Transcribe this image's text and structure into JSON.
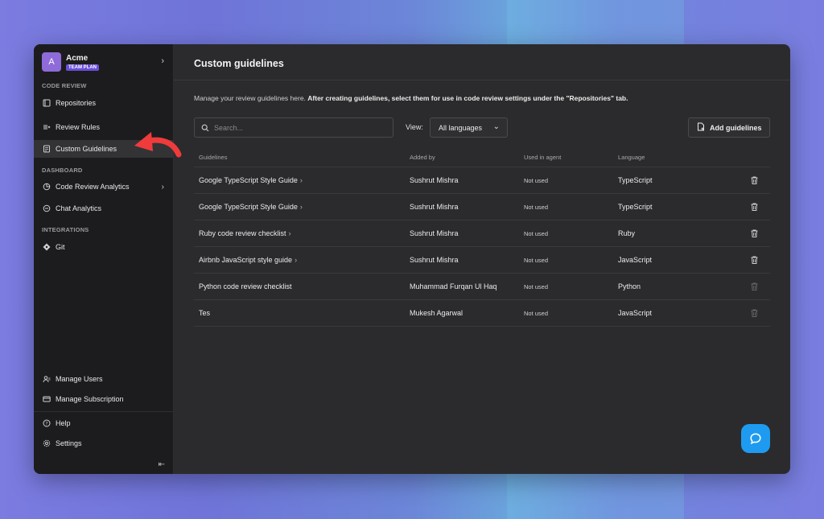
{
  "org": {
    "initial": "A",
    "name": "Acme",
    "plan": "TEAM PLAN"
  },
  "sidebar": {
    "section_code_review": "CODE REVIEW",
    "section_dashboard": "DASHBOARD",
    "section_integrations": "INTEGRATIONS",
    "items": [
      {
        "label": "Repositories",
        "icon": "repositories-icon"
      },
      {
        "label": "Review Rules",
        "icon": "review-rules-icon"
      },
      {
        "label": "Custom Guidelines",
        "icon": "guidelines-icon",
        "active": true
      },
      {
        "label": "Code Review Analytics",
        "icon": "analytics-icon"
      },
      {
        "label": "Chat Analytics",
        "icon": "chat-analytics-icon"
      },
      {
        "label": "Git",
        "icon": "git-icon"
      }
    ],
    "bottom_items": [
      {
        "label": "Manage Users",
        "icon": "users-icon"
      },
      {
        "label": "Manage Subscription",
        "icon": "card-icon"
      },
      {
        "label": "Help",
        "icon": "help-icon"
      },
      {
        "label": "Settings",
        "icon": "gear-icon"
      }
    ]
  },
  "main": {
    "title": "Custom guidelines",
    "desc_plain": "Manage your review guidelines here. ",
    "desc_bold": "After creating guidelines, select them for use in code review settings under the \"Repositories\" tab.",
    "search_placeholder": "Search...",
    "view_label": "View:",
    "view_value": "All languages",
    "add_button": "Add guidelines"
  },
  "table": {
    "headers": [
      "Guidelines",
      "Added by",
      "Used in agent",
      "Language"
    ],
    "rows": [
      {
        "name": "Google TypeScript Style Guide",
        "added_by": "Sushrut Mishra",
        "used": "Not used",
        "language": "TypeScript",
        "has_chevron": true,
        "delete_enabled": true
      },
      {
        "name": "Google TypeScript Style Guide",
        "added_by": "Sushrut Mishra",
        "used": "Not used",
        "language": "TypeScript",
        "has_chevron": true,
        "delete_enabled": true
      },
      {
        "name": "Ruby code review checklist",
        "added_by": "Sushrut Mishra",
        "used": "Not used",
        "language": "Ruby",
        "has_chevron": true,
        "delete_enabled": true
      },
      {
        "name": "Airbnb JavaScript style guide",
        "added_by": "Sushrut Mishra",
        "used": "Not used",
        "language": "JavaScript",
        "has_chevron": true,
        "delete_enabled": true
      },
      {
        "name": "Python code review checklist",
        "added_by": "Muhammad Furqan Ul Haq",
        "used": "Not used",
        "language": "Python",
        "has_chevron": false,
        "delete_enabled": false
      },
      {
        "name": "Tes",
        "added_by": "Mukesh Agarwal",
        "used": "Not used",
        "language": "JavaScript",
        "has_chevron": false,
        "delete_enabled": false
      }
    ]
  },
  "colors": {
    "accent": "#6b4fd8",
    "chat": "#1e9bf0",
    "arrow": "#ef3b3b"
  }
}
